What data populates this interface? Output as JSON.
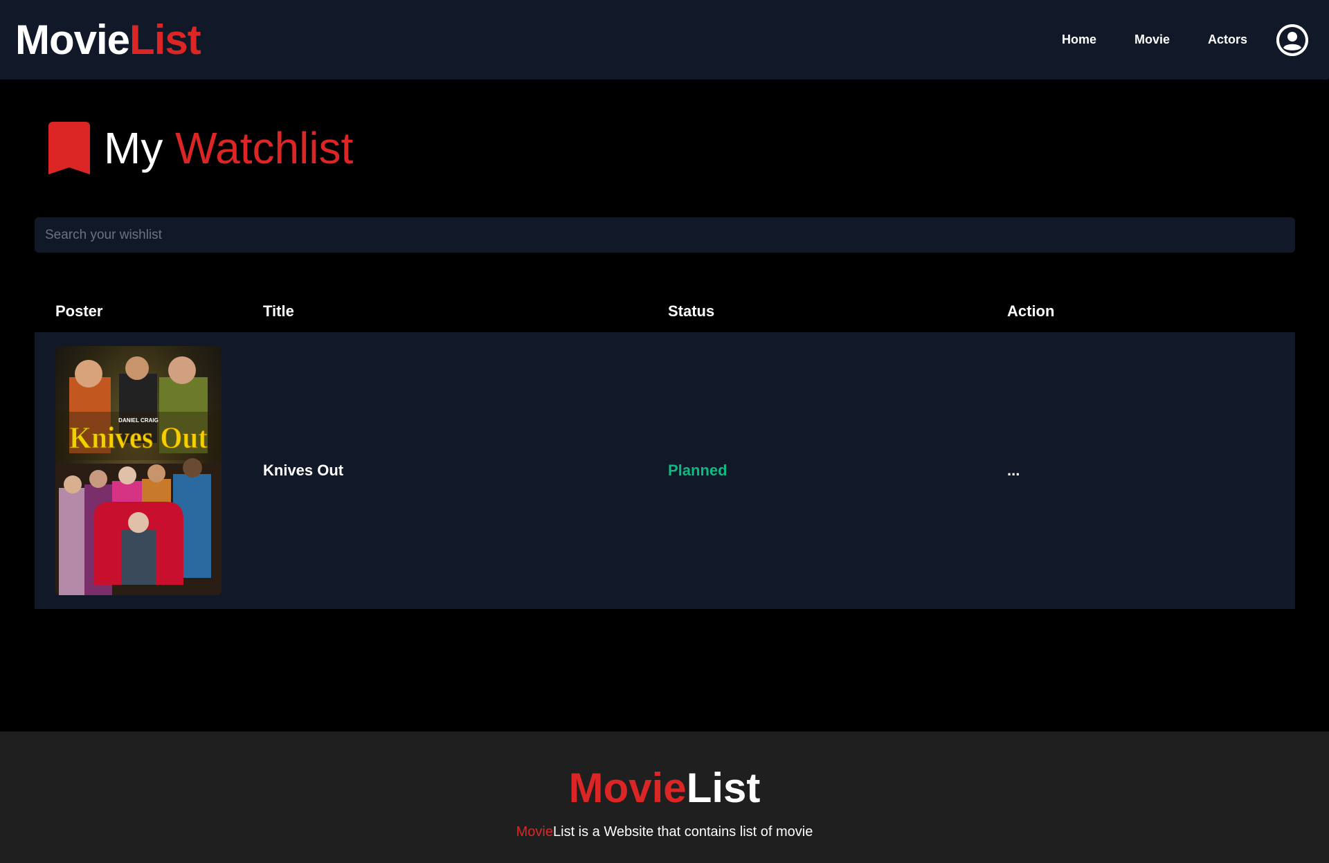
{
  "brand": {
    "part1": "Movie",
    "part2": "List"
  },
  "nav": {
    "items": [
      {
        "label": "Home"
      },
      {
        "label": "Movie"
      },
      {
        "label": "Actors"
      }
    ]
  },
  "page": {
    "title_part1": "My",
    "title_part2": "Watchlist"
  },
  "search": {
    "placeholder": "Search your wishlist",
    "value": ""
  },
  "table": {
    "headers": {
      "poster": "Poster",
      "title": "Title",
      "status": "Status",
      "action": "Action"
    },
    "rows": [
      {
        "title": "Knives Out",
        "status": "Planned",
        "action": "...",
        "poster_text": "Knives Out",
        "poster_credit": "DANIEL CRAIG"
      }
    ]
  },
  "footer": {
    "brand_part1": "Movie",
    "brand_part2": "List",
    "desc_highlight": "Movie",
    "desc_rest": "List is a Website that contains list of movie"
  },
  "colors": {
    "accent": "#dc2626",
    "nav_bg": "#111827",
    "status_planned": "#10b981",
    "footer_bg": "#1f1f1f"
  },
  "icons": {
    "bookmark": "bookmark-icon",
    "user": "user-circle-icon"
  }
}
